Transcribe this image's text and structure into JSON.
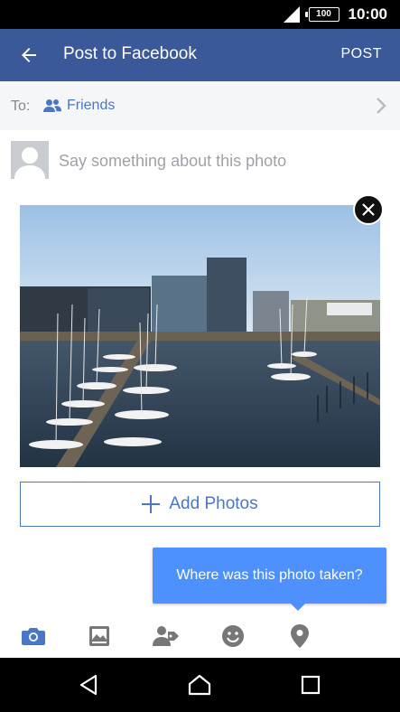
{
  "status": {
    "battery": "100",
    "time": "10:00"
  },
  "appbar": {
    "title": "Post to Facebook",
    "post_label": "POST"
  },
  "audience": {
    "to_label": "To:",
    "value": "Friends"
  },
  "compose": {
    "placeholder": "Say something about this photo"
  },
  "add_photos": {
    "label": "Add Photos"
  },
  "tooltip": {
    "text": "Where was this photo taken?"
  },
  "toolbar": {
    "icons": [
      "camera-icon",
      "photo-album-icon",
      "tag-people-icon",
      "emoji-icon",
      "location-pin-icon"
    ],
    "active_color": "#4a76c7",
    "inactive_color": "#777777"
  },
  "colors": {
    "facebook_blue": "#3b5998",
    "link_blue": "#4a76c7",
    "tooltip_blue": "#4d90fe"
  }
}
